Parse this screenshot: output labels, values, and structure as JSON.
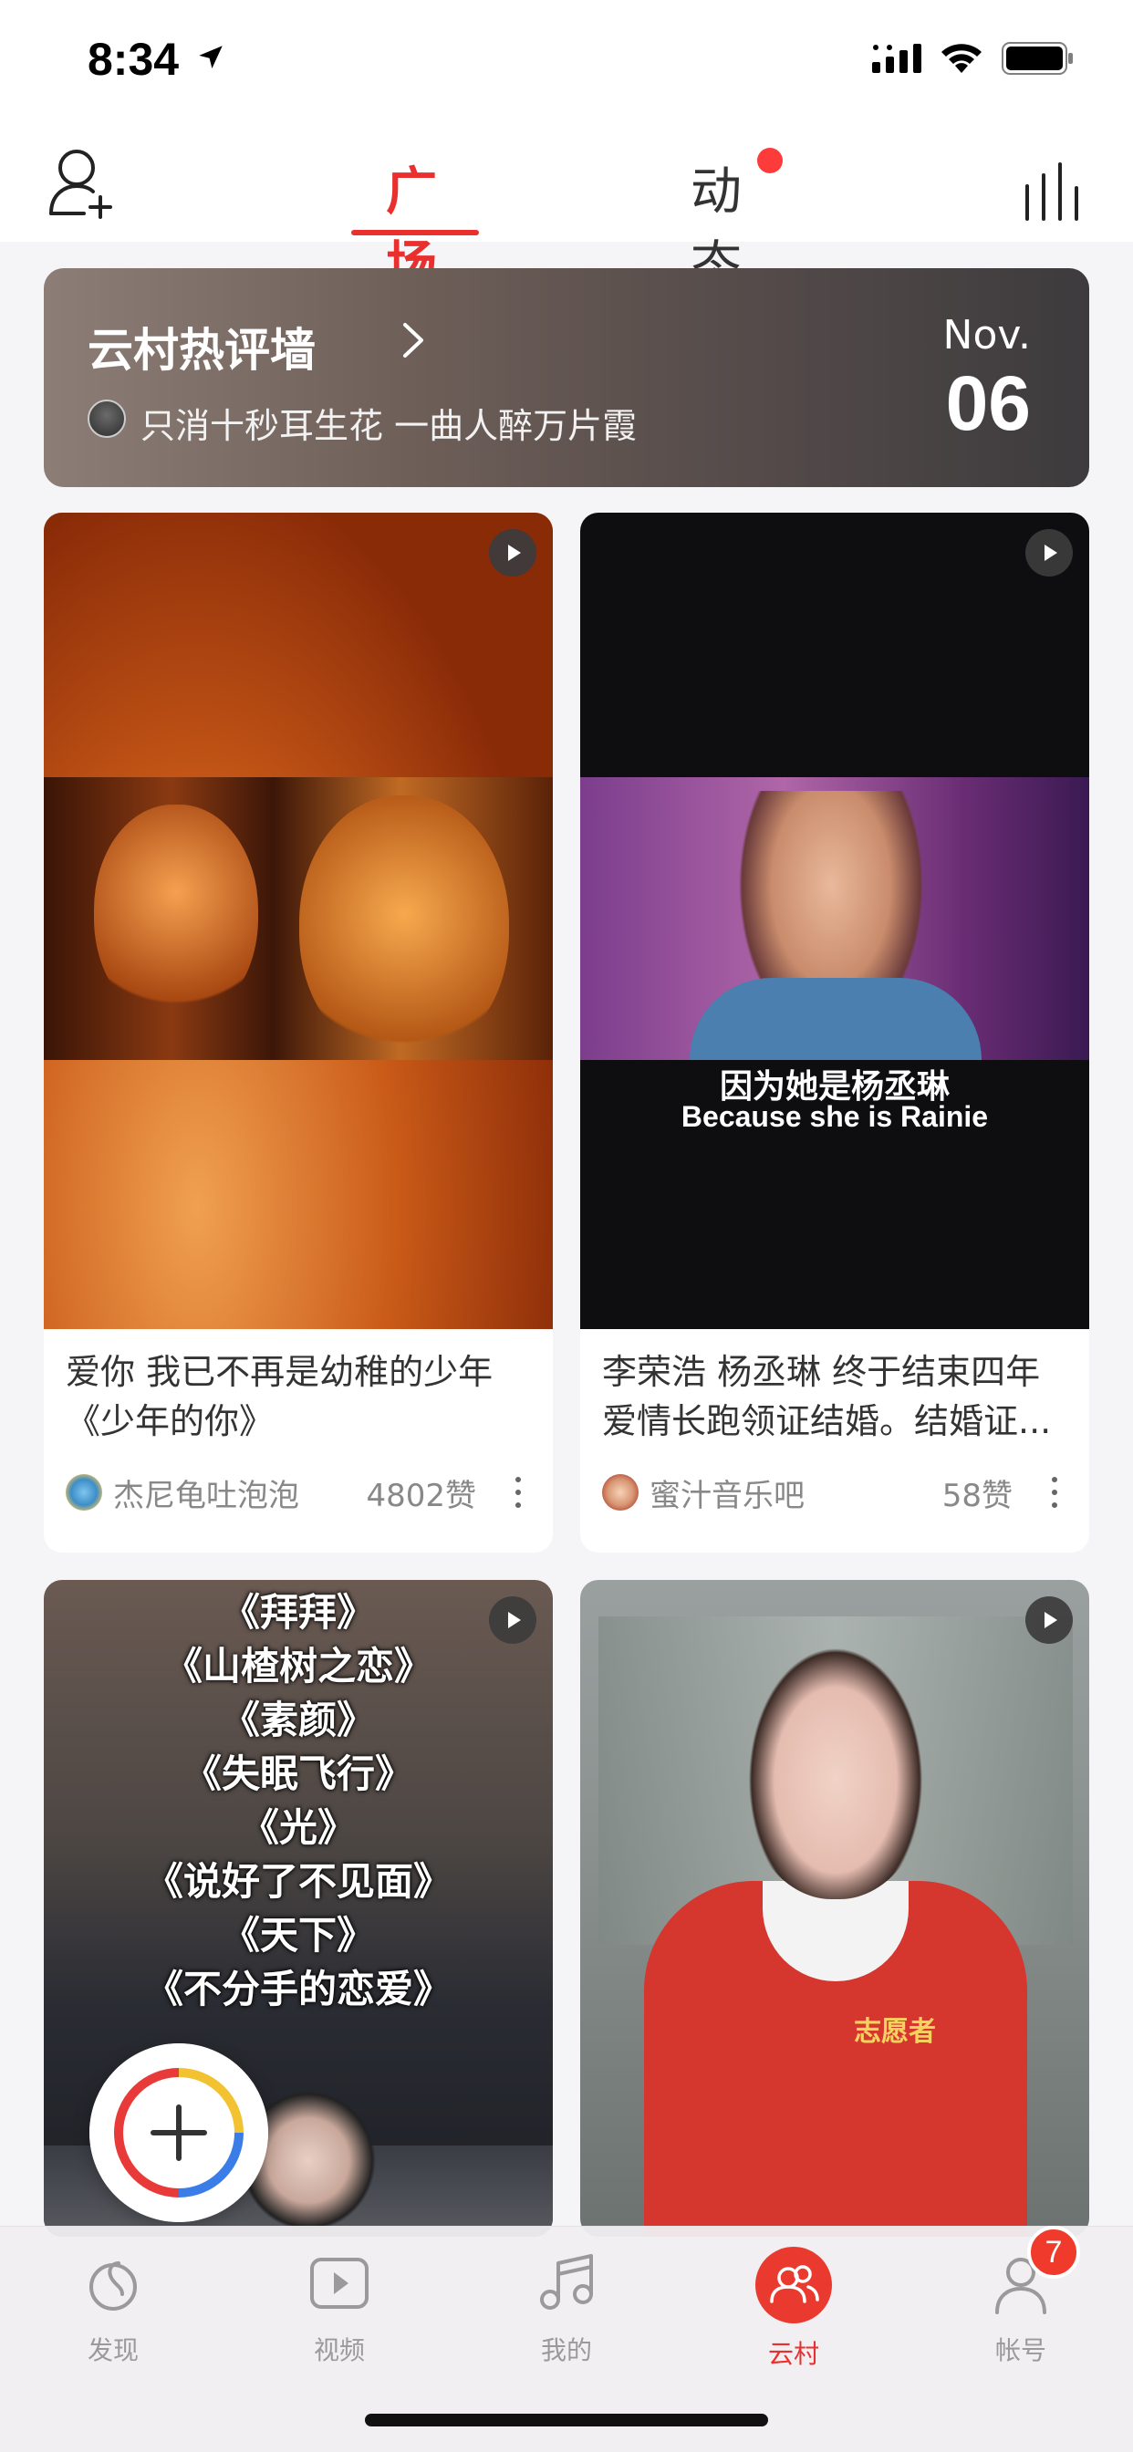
{
  "status_bar": {
    "time": "8:34"
  },
  "header": {
    "tabs": [
      {
        "label": "广场",
        "active": true
      },
      {
        "label": "动态",
        "active": false,
        "has_dot": true
      }
    ]
  },
  "banner": {
    "title": "云村热评墙",
    "subtitle": "只消十秒耳生花 一曲人醉万片霞",
    "month": "Nov.",
    "day": "06"
  },
  "cards": [
    {
      "title_line1": "爱你 我已不再是幼稚的少年",
      "title_line2": "《少年的你》",
      "author": "杰尼龟吐泡泡",
      "likes": "4802赞"
    },
    {
      "title_line1": "李荣浩 杨丞琳 终于结束四年",
      "title_line2": "爱情长跑领证结婚。结婚证...",
      "author": "蜜汁音乐吧",
      "likes": "58赞",
      "caption_cn": "因为她是杨丞琳",
      "caption_en": "Because she is Rainie"
    },
    {
      "songs": [
        "《拜拜》",
        "《山楂树之恋》",
        "《素颜》",
        "《失眠飞行》",
        "《光》",
        "《说好了不见面》",
        "《天下》",
        "《不分手的恋爱》"
      ]
    },
    {
      "badge_text": "志愿者"
    }
  ],
  "bottom_nav": {
    "items": [
      {
        "label": "发现",
        "icon": "netease-music-icon"
      },
      {
        "label": "视频",
        "icon": "video-play-icon"
      },
      {
        "label": "我的",
        "icon": "music-note-icon"
      },
      {
        "label": "云村",
        "icon": "community-icon",
        "active": true
      },
      {
        "label": "帐号",
        "icon": "user-icon"
      }
    ],
    "account_badge": "7"
  },
  "colors": {
    "accent": "#e9302f",
    "background": "#f5f5f7"
  }
}
